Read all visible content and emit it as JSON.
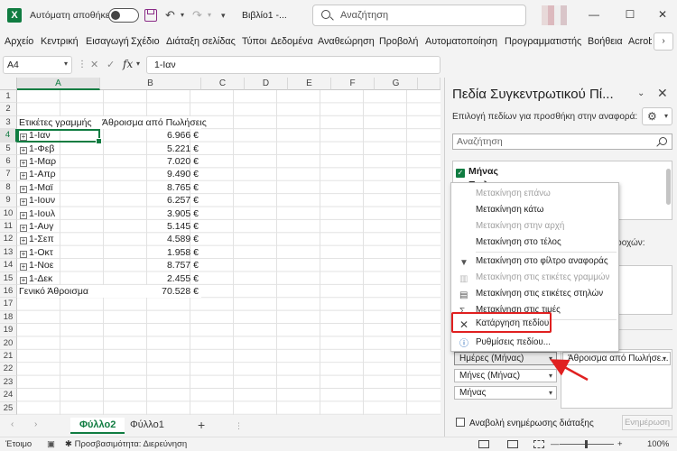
{
  "titlebar": {
    "app_icon": "X",
    "autosave_label": "Αυτόματη αποθήκευση",
    "autosave_state": "off",
    "doc_title": "Βιβλίο1 -...",
    "search_placeholder": "Αναζήτηση",
    "minimize": "—",
    "maximize": "☐",
    "close": "✕"
  },
  "ribbon": {
    "tabs": [
      "Αρχείο",
      "Κεντρική",
      "Εισαγωγή",
      "Σχέδιο",
      "Διάταξη σελίδας",
      "Τύποι",
      "Δεδομένα",
      "Αναθεώρηση",
      "Προβολή",
      "Αυτοματοποίηση",
      "Προγραμματιστής",
      "Βοήθεια",
      "Acroba"
    ]
  },
  "formula_bar": {
    "name_box": "A4",
    "fx": "fx",
    "content": "1-Ιαν"
  },
  "grid": {
    "columns": [
      "A",
      "B",
      "C",
      "D",
      "E",
      "F",
      "G"
    ],
    "selected_column": "A",
    "selected_row": "4",
    "row_numbers": [
      "1",
      "2",
      "3",
      "4",
      "5",
      "6",
      "7",
      "8",
      "9",
      "10",
      "11",
      "12",
      "13",
      "14",
      "15",
      "16",
      "17",
      "18",
      "19",
      "20",
      "21",
      "22",
      "23",
      "24",
      "25"
    ],
    "header_row_label": "Ετικέτες γραμμής",
    "header_value": "Άθροισμα από Πωλήσεις",
    "rows": [
      {
        "label": "1-Ιαν",
        "value": "6.966 €"
      },
      {
        "label": "1-Φεβ",
        "value": "5.221 €"
      },
      {
        "label": "1-Μαρ",
        "value": "7.020 €"
      },
      {
        "label": "1-Απρ",
        "value": "9.490 €"
      },
      {
        "label": "1-Μαϊ",
        "value": "8.765 €"
      },
      {
        "label": "1-Ιουν",
        "value": "6.257 €"
      },
      {
        "label": "1-Ιουλ",
        "value": "3.905 €"
      },
      {
        "label": "1-Αυγ",
        "value": "5.145 €"
      },
      {
        "label": "1-Σεπ",
        "value": "4.589 €"
      },
      {
        "label": "1-Οκτ",
        "value": "1.958 €"
      },
      {
        "label": "1-Νοε",
        "value": "8.757 €"
      },
      {
        "label": "1-Δεκ",
        "value": "2.455 €"
      }
    ],
    "grand_total_label": "Γενικό Άθροισμα",
    "grand_total_value": "70.528 €"
  },
  "sheets": {
    "tabs": [
      "Φύλλο2",
      "Φύλλο1"
    ],
    "active": "Φύλλο2",
    "add": "+"
  },
  "status": {
    "ready": "Έτοιμο",
    "accessibility": "Προσβασιμότητα: Διερεύνηση",
    "zoom_out": "—",
    "zoom_in": "+",
    "zoom": "100%"
  },
  "pivot_pane": {
    "title": "Πεδία Συγκεντρωτικού Πί...",
    "subtitle": "Επιλογή πεδίων για προσθήκη στην αναφορά:",
    "search_placeholder": "Αναζήτηση",
    "fields": [
      {
        "name": "Μήνας",
        "checked": true
      },
      {
        "name": "Πωλ...",
        "checked": true
      }
    ],
    "areas_tail": "ροχών:",
    "rows_area": [
      "Ημέρες (Μήνας)",
      "Μήνες (Μήνας)",
      "Μήνας"
    ],
    "values_area": [
      "Άθροισμα από Πωλήσε..."
    ],
    "defer_label": "Αναβολή ενημέρωσης διάταξης",
    "update_button": "Ενημέρωση"
  },
  "context_menu": {
    "items": [
      {
        "label": "Μετακίνηση επάνω",
        "enabled": false,
        "icon": ""
      },
      {
        "label": "Μετακίνηση κάτω",
        "enabled": true,
        "icon": ""
      },
      {
        "label": "Μετακίνηση στην αρχή",
        "enabled": false,
        "icon": ""
      },
      {
        "label": "Μετακίνηση στο τέλος",
        "enabled": true,
        "icon": ""
      },
      {
        "label": "Μετακίνηση στο φίλτρο αναφοράς",
        "enabled": true,
        "icon": "filter-icon"
      },
      {
        "label": "Μετακίνηση στις ετικέτες γραμμών",
        "enabled": false,
        "icon": "rows-icon"
      },
      {
        "label": "Μετακίνηση στις ετικέτες στηλών",
        "enabled": true,
        "icon": "columns-icon"
      },
      {
        "label": "Μετακίνηση στις τιμές",
        "enabled": true,
        "icon": "sigma-icon"
      },
      {
        "label": "Κατάργηση πεδίου",
        "enabled": true,
        "icon": "remove-field-icon"
      },
      {
        "label": "Ρυθμίσεις πεδίου...",
        "enabled": true,
        "icon": "field-settings-icon"
      }
    ]
  },
  "colors": {
    "excel_green": "#107c41",
    "highlight_red": "#e02020"
  }
}
